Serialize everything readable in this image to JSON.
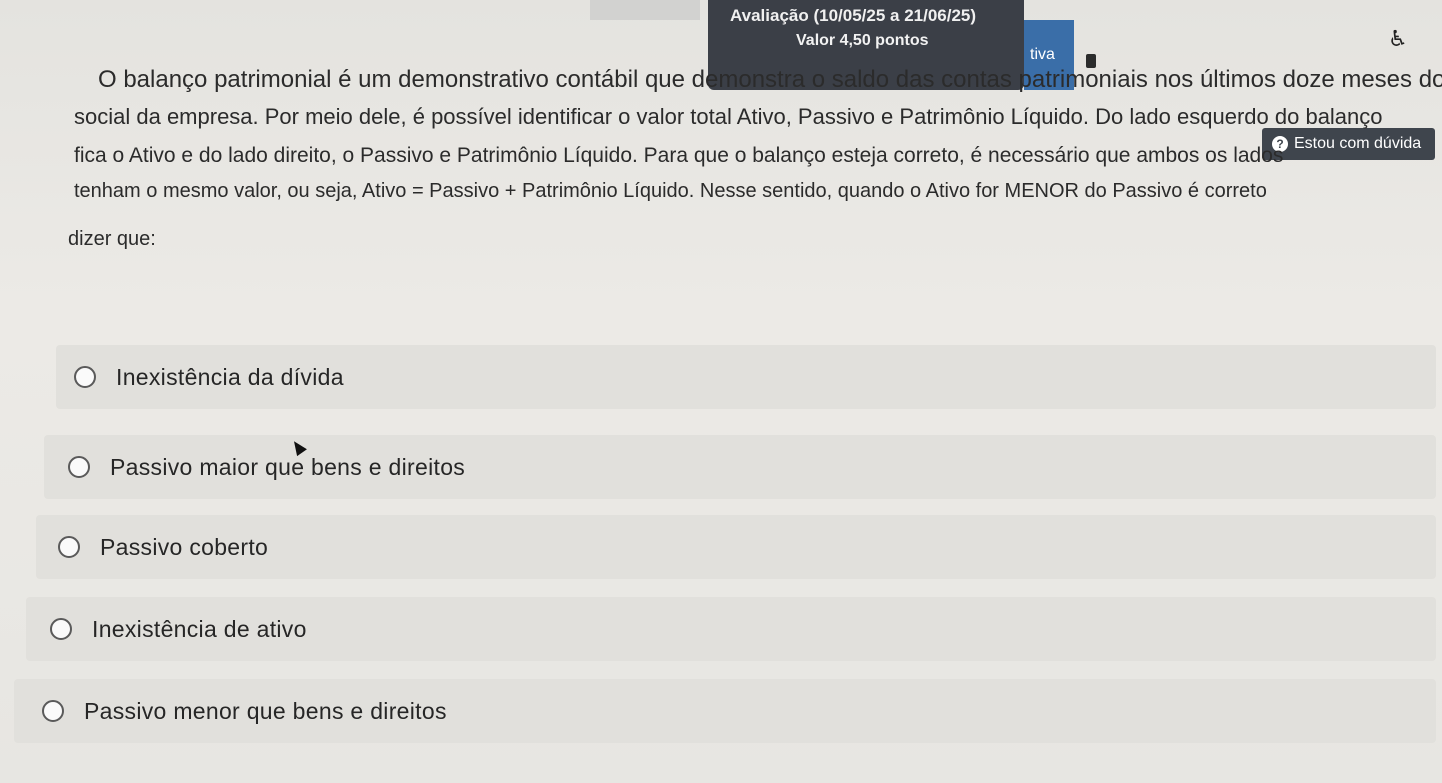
{
  "header": {
    "evaluation_title": "Avaliação (10/05/25 a 21/06/25)",
    "evaluation_value": "Valor 4,50 pontos",
    "mode_tab_label": "tiva"
  },
  "help_button": {
    "label": "Estou com dúvida"
  },
  "question": {
    "lines": [
      "O balanço patrimonial é um demonstrativo contábil que demonstra o saldo das contas patrimoniais nos últimos doze meses do exercício",
      "social da empresa. Por meio dele, é possível identificar o valor total Ativo, Passivo e Patrimônio Líquido. Do lado esquerdo do balanço",
      "fica o Ativo e do lado direito, o Passivo e Patrimônio Líquido. Para que o balanço esteja correto, é necessário que ambos os lados",
      "tenham o mesmo valor, ou seja, Ativo = Passivo + Patrimônio Líquido. Nesse sentido, quando o Ativo for MENOR do Passivo é correto",
      "dizer que:"
    ]
  },
  "options": [
    {
      "label": "Inexistência da dívida"
    },
    {
      "label": "Passivo maior que bens e direitos"
    },
    {
      "label": "Passivo coberto"
    },
    {
      "label": "Inexistência de ativo"
    },
    {
      "label": "Passivo menor que bens e direitos"
    }
  ],
  "colors": {
    "header_dark": "#3b3f47",
    "mode_tab": "#3a6ea8",
    "help_button": "#3f454d",
    "background": "#e9e8e4",
    "option_background": "#e1e0dc"
  },
  "icons": [
    "accessibility-icon",
    "document-icon",
    "question-circle-icon",
    "radio-button-icon",
    "mouse-cursor-icon"
  ]
}
